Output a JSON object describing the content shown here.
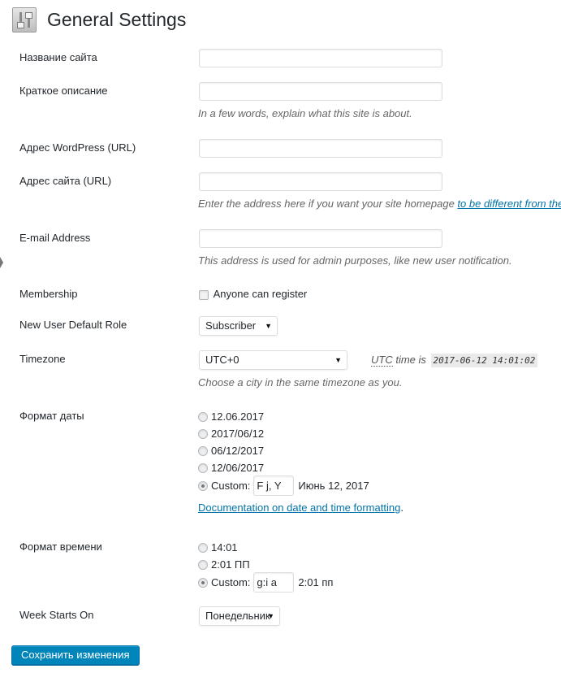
{
  "header": {
    "title": "General Settings",
    "icon": "settings-sliders-icon"
  },
  "fields": {
    "site_title": {
      "label": "Название сайта",
      "value": ""
    },
    "tagline": {
      "label": "Краткое описание",
      "value": "",
      "description": "In a few words, explain what this site is about."
    },
    "wp_address": {
      "label": "Адрес WordPress (URL)",
      "value": ""
    },
    "site_address": {
      "label": "Адрес сайта (URL)",
      "value": "",
      "description_prefix": "Enter the address here if you want your site homepage ",
      "description_link": "to be different from the direct"
    },
    "email": {
      "label": "E-mail Address",
      "value": "",
      "description": "This address is used for admin purposes, like new user notification."
    },
    "membership": {
      "label": "Membership",
      "checkbox_label": "Anyone can register",
      "checked": false
    },
    "default_role": {
      "label": "New User Default Role",
      "selected": "Subscriber"
    },
    "timezone": {
      "label": "Timezone",
      "selected": "UTC+0",
      "utc_abbr": "UTC",
      "utc_text": "time is",
      "utc_time": "2017-06-12 14:01:02",
      "description": "Choose a city in the same timezone as you."
    },
    "date_format": {
      "label": "Формат даты",
      "options": [
        "12.06.2017",
        "2017/06/12",
        "06/12/2017",
        "12/06/2017"
      ],
      "custom_label": "Custom:",
      "custom_value": "F j, Y",
      "custom_preview": "Июнь 12, 2017",
      "selected": "custom",
      "doc_link": "Documentation on date and time formatting",
      "doc_suffix": "."
    },
    "time_format": {
      "label": "Формат времени",
      "options": [
        "14:01",
        "2:01 ПП"
      ],
      "custom_label": "Custom:",
      "custom_value": "g:i a",
      "custom_preview": "2:01 пп",
      "selected": "custom"
    },
    "week_start": {
      "label": "Week Starts On",
      "selected": "Понедельник"
    }
  },
  "actions": {
    "save_label": "Сохранить изменения"
  },
  "colors": {
    "accent": "#0085ba",
    "link": "#0073aa"
  }
}
